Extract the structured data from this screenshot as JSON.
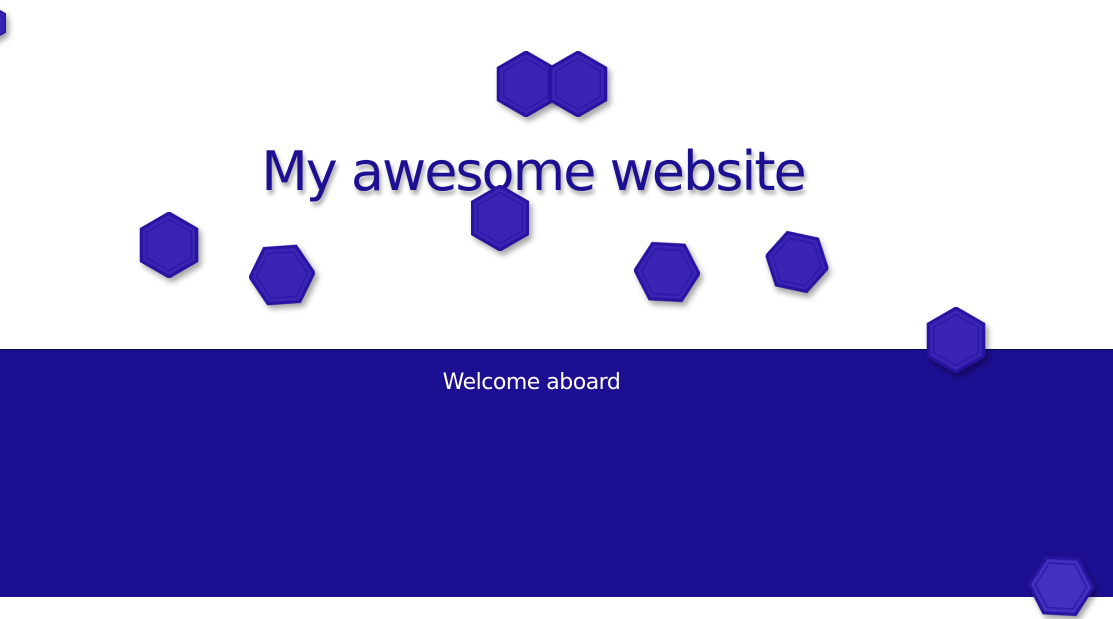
{
  "hero": {
    "title": "My awesome website"
  },
  "welcome": {
    "text": "Welcome aboard"
  },
  "colors": {
    "primary": "#1d0f91",
    "hex_fill": "#3a24b4",
    "hex_border": "#2814a0",
    "background": "#ffffff",
    "text_light": "#ffffff"
  },
  "decorations": {
    "icon": "hexagon-icon",
    "count": 12
  }
}
